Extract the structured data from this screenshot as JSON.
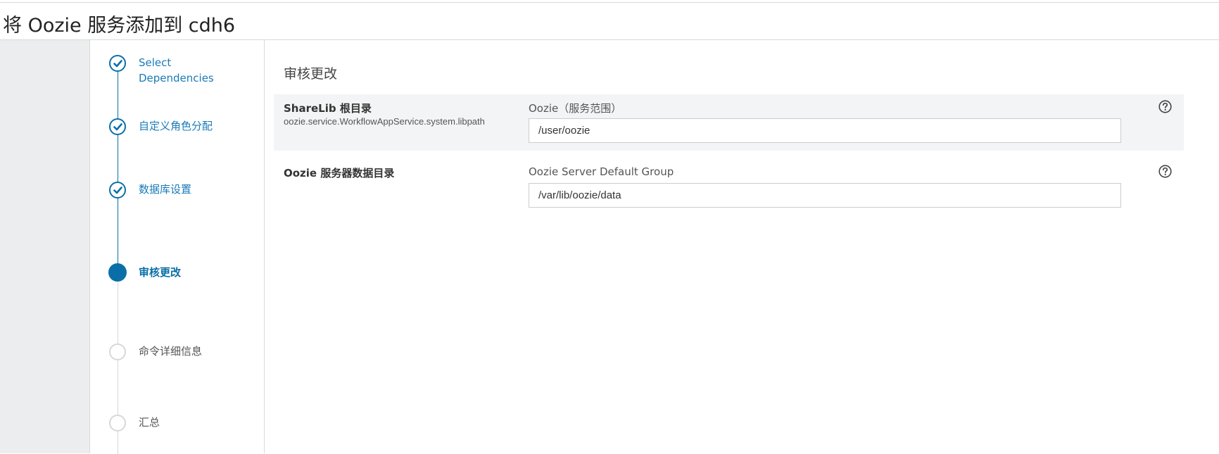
{
  "page": {
    "title": "将 Oozie 服务添加到 cdh6"
  },
  "steps": [
    {
      "label_line1": "Select",
      "label_line2": "Dependencies",
      "status": "done"
    },
    {
      "label": "自定义角色分配",
      "status": "done"
    },
    {
      "label": "数据库设置",
      "status": "done"
    },
    {
      "label": "审核更改",
      "status": "active"
    },
    {
      "label": "命令详细信息",
      "status": "pending"
    },
    {
      "label": "汇总",
      "status": "pending"
    }
  ],
  "main": {
    "section_title": "审核更改",
    "properties": [
      {
        "name": "ShareLib 根目录",
        "key": "oozie.service.WorkflowAppService.system.libpath",
        "scope": "Oozie（服务范围）",
        "value": "/user/oozie"
      },
      {
        "name": "Oozie 服务器数据目录",
        "scope": "Oozie Server Default Group",
        "value": "/var/lib/oozie/data"
      }
    ]
  },
  "colors": {
    "accent": "#0a6fa8",
    "link": "#1a7bb9",
    "pending": "#d6d8da",
    "row_shade": "#f3f4f5",
    "gutter": "#ebedee"
  },
  "icons": {
    "done_step": "check-circle-icon",
    "active_step": "filled-circle-icon",
    "pending_step": "empty-circle-icon",
    "help": "question-circle-icon"
  }
}
